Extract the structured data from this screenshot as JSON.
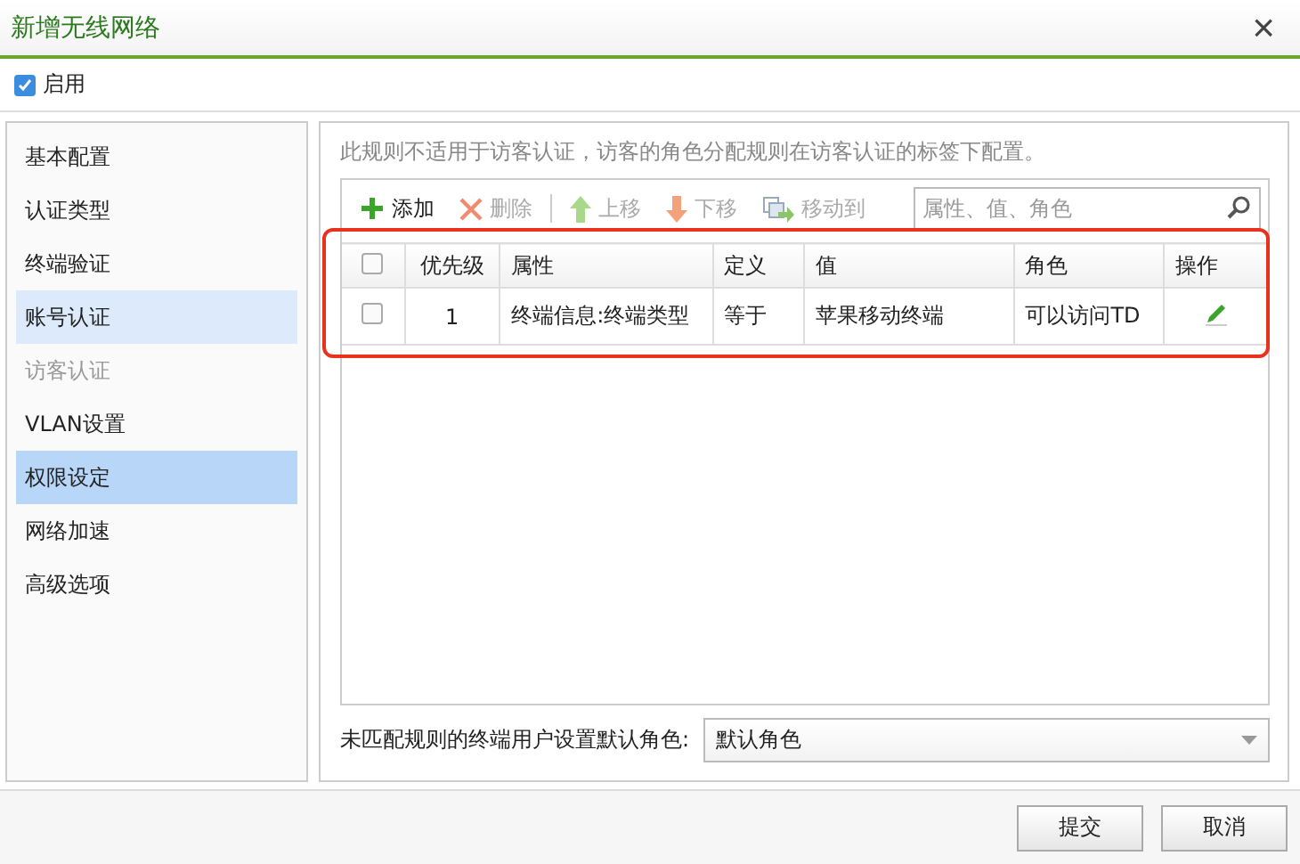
{
  "window": {
    "title": "新增无线网络",
    "close": "×"
  },
  "enable": {
    "label": "启用",
    "checked": true
  },
  "sidebar": {
    "items": [
      {
        "label": "基本配置",
        "selected": false,
        "hovered": false,
        "disabled": false
      },
      {
        "label": "认证类型",
        "selected": false,
        "hovered": false,
        "disabled": false
      },
      {
        "label": "终端验证",
        "selected": false,
        "hovered": false,
        "disabled": false
      },
      {
        "label": "账号认证",
        "selected": false,
        "hovered": true,
        "disabled": false
      },
      {
        "label": "访客认证",
        "selected": false,
        "hovered": false,
        "disabled": true
      },
      {
        "label": "VLAN设置",
        "selected": false,
        "hovered": false,
        "disabled": false
      },
      {
        "label": "权限设定",
        "selected": true,
        "hovered": false,
        "disabled": false
      },
      {
        "label": "网络加速",
        "selected": false,
        "hovered": false,
        "disabled": false
      },
      {
        "label": "高级选项",
        "selected": false,
        "hovered": false,
        "disabled": false
      }
    ]
  },
  "notice": "此规则不适用于访客认证，访客的角色分配规则在访客认证的标签下配置。",
  "toolbar": {
    "buttons": [
      {
        "kind": "add",
        "label": "添加",
        "disabled": false
      },
      {
        "kind": "delete",
        "label": "删除",
        "disabled": true
      },
      {
        "kind": "up",
        "label": "上移",
        "disabled": true
      },
      {
        "kind": "down",
        "label": "下移",
        "disabled": true
      },
      {
        "kind": "move",
        "label": "移动到",
        "disabled": true
      }
    ],
    "search": {
      "placeholder": "属性、值、角色"
    }
  },
  "table": {
    "select_all": {
      "checked": false
    },
    "columns": [
      "优先级",
      "属性",
      "定义",
      "值",
      "角色",
      "操作"
    ],
    "rows": [
      {
        "checked": false,
        "cells": [
          "1",
          "终端信息:终端类型",
          "等于",
          "苹果移动终端",
          "可以访问TD"
        ]
      }
    ]
  },
  "default_role": {
    "label": "未匹配规则的终端用户设置默认角色:",
    "value": "默认角色"
  },
  "buttons": [
    "提交",
    "取消"
  ]
}
